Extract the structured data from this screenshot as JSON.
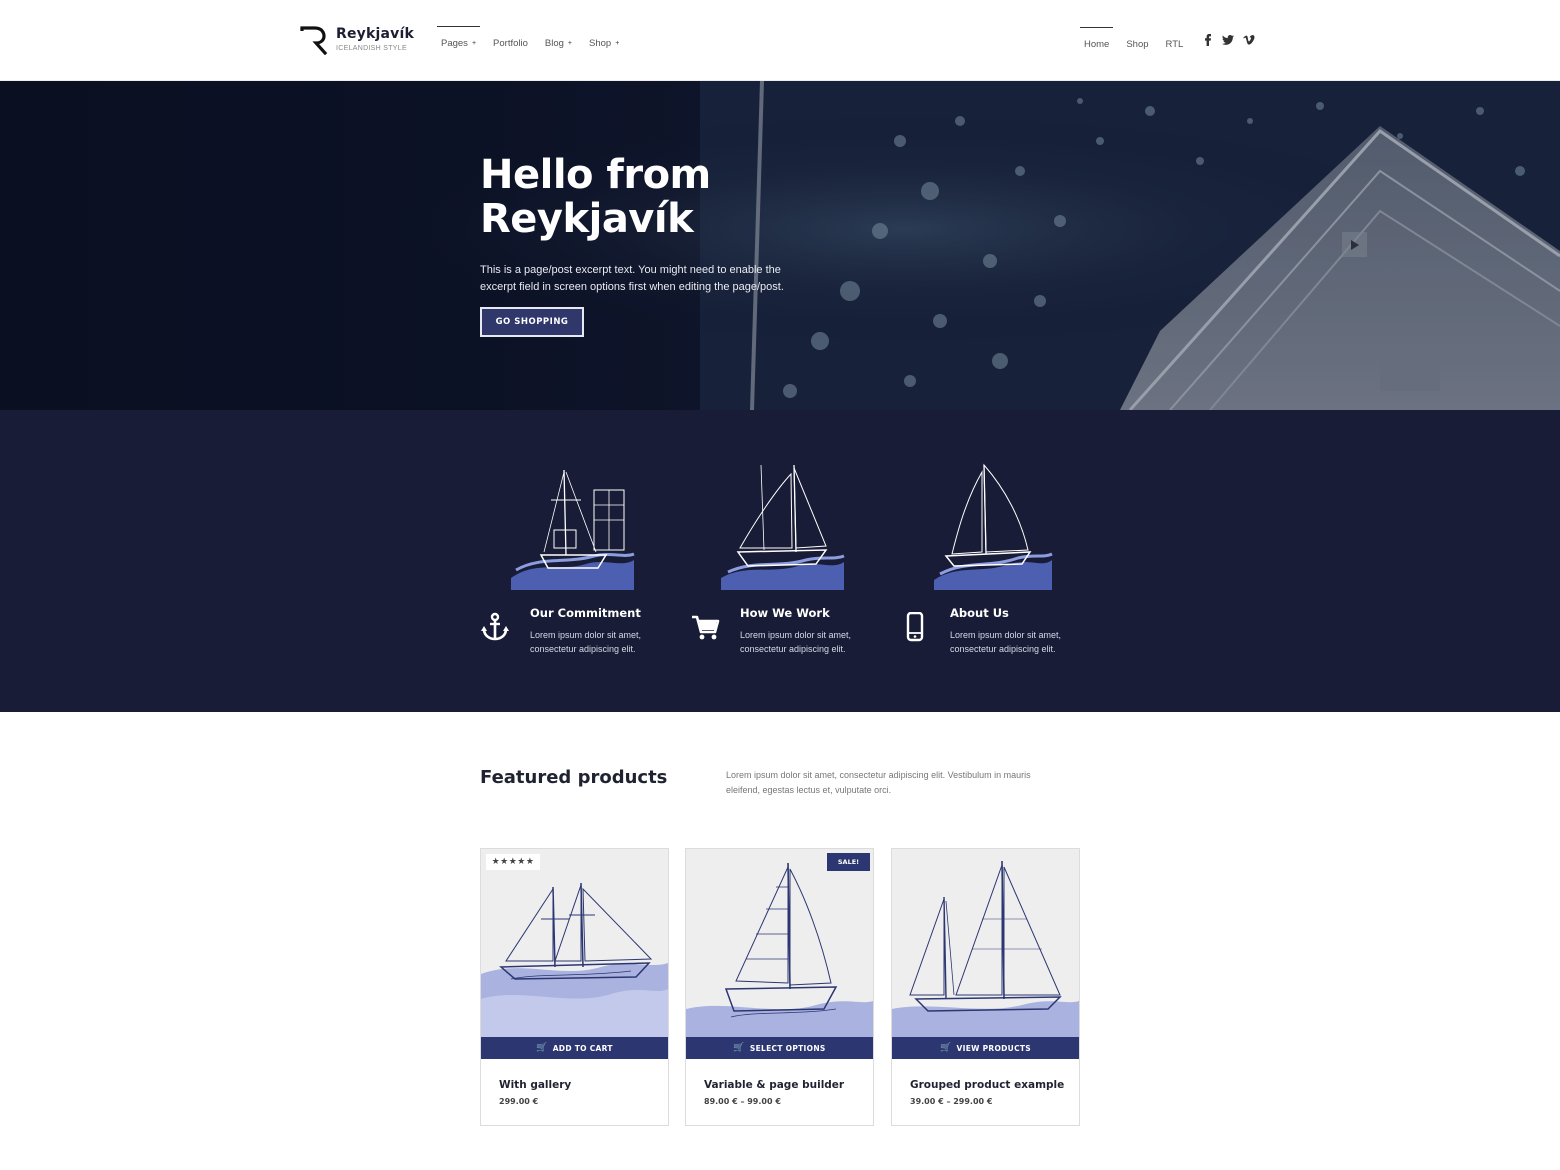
{
  "brand": {
    "name": "Reykjavík",
    "tagline": "ICELANDISH STYLE"
  },
  "nav_left": [
    {
      "label": "Pages",
      "caret": "+"
    },
    {
      "label": "Portfolio",
      "caret": ""
    },
    {
      "label": "Blog",
      "caret": "+"
    },
    {
      "label": "Shop",
      "caret": "+"
    }
  ],
  "nav_right": [
    {
      "label": "Home"
    },
    {
      "label": "Shop"
    },
    {
      "label": "RTL"
    }
  ],
  "socials": [
    "facebook-icon",
    "twitter-icon",
    "vimeo-icon"
  ],
  "hero": {
    "title_line1": "Hello from",
    "title_line2": "Reykjavík",
    "text": "This is a page/post excerpt text. You might need to enable the excerpt field in screen options first when editing the page/post.",
    "button": "GO SHOPPING"
  },
  "features": [
    {
      "icon": "anchor-icon",
      "title": "Our Commitment",
      "text": "Lorem ipsum dolor sit amet, consectetur adipiscing elit."
    },
    {
      "icon": "cart-icon",
      "title": "How We Work",
      "text": "Lorem ipsum dolor sit amet, consectetur adipiscing elit."
    },
    {
      "icon": "phone-icon",
      "title": "About Us",
      "text": "Lorem ipsum dolor sit amet, consectetur adipiscing elit."
    }
  ],
  "featured": {
    "title": "Featured products",
    "description": "Lorem ipsum dolor sit amet, consectetur adipiscing elit. Vestibulum in mauris eleifend, egestas lectus et, vulputate orci."
  },
  "products": [
    {
      "name": "With gallery",
      "price": "299.00 €",
      "button": "ADD TO CART",
      "badge": "★★★★★"
    },
    {
      "name": "Variable & page builder",
      "price": "89.00 € – 99.00 €",
      "button": "SELECT OPTIONS",
      "badge": "SALE!"
    },
    {
      "name": "Grouped product example",
      "price": "39.00 € – 299.00 €",
      "button": "VIEW PRODUCTS",
      "badge": ""
    }
  ],
  "colors": {
    "navy": "#191c37",
    "button": "#2c3671",
    "hero_bg": "#0b1024"
  }
}
